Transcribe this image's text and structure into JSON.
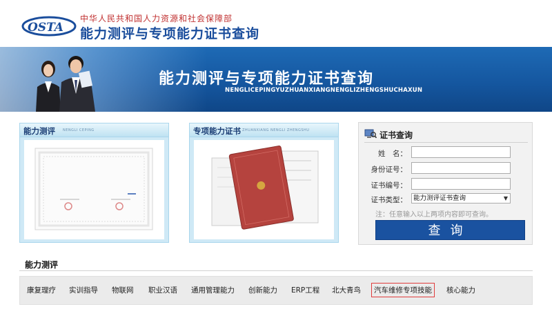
{
  "header": {
    "logo_text": "OSTA",
    "ministry": "中华人民共和国人力资源和社会保障部",
    "site_title": "能力测评与专项能力证书查询"
  },
  "banner": {
    "title": "能力测评与专项能力证书查询",
    "pinyin": "NENGLICEPINGYUZHUANXIANGNENGLIZHENGSHUCHAXUN"
  },
  "panels": {
    "ability": {
      "title": "能力测评",
      "subtitle": "NENGLI CEPING"
    },
    "special": {
      "title": "专项能力证书",
      "subtitle": "ZHUANXIANG NENGLI ZHENGSHU"
    }
  },
  "query": {
    "title": "证书查询",
    "name_label": "姓　名：",
    "id_label": "身份证号：",
    "cert_no_label": "证书编号：",
    "cert_type_label": "证书类型：",
    "cert_type_selected": "能力测评证书查询",
    "note": "注：任意输入以上两项内容即可查询。",
    "button_label": "查询"
  },
  "ability_section": {
    "title": "能力测评",
    "items": [
      "康复理疗",
      "实训指导",
      "物联网",
      "职业汉语",
      "通用管理能力",
      "创新能力",
      "ERP工程",
      "北大青鸟",
      "汽车维修专项技能",
      "核心能力"
    ]
  },
  "colors": {
    "brand_blue": "#1a4d9c",
    "banner_blue": "#1557a0",
    "button_blue": "#1a52a0",
    "highlight_red": "#e03b3b"
  }
}
